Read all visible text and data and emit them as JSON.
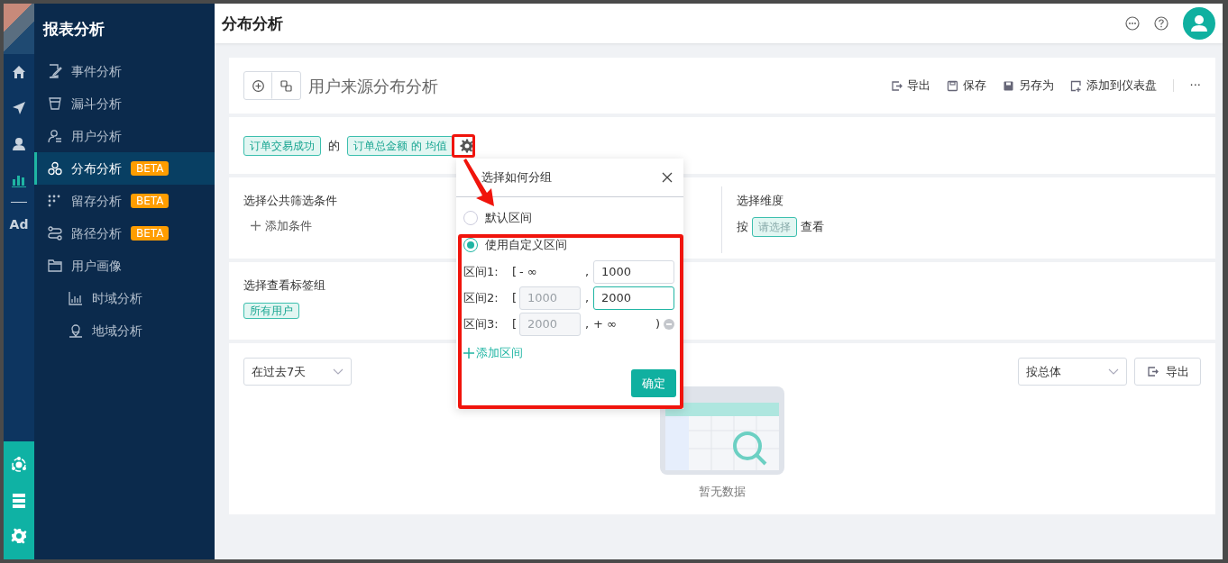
{
  "icon_rail": {
    "items": [
      {
        "selected": false
      },
      {
        "selected": false
      },
      {
        "selected": false
      },
      {
        "selected": true
      },
      {
        "text": "Ad",
        "selected": false
      }
    ]
  },
  "sidebar": {
    "title": "报表分析",
    "items": [
      {
        "label": "事件分析",
        "selected": false
      },
      {
        "label": "漏斗分析",
        "selected": false
      },
      {
        "label": "用户分析",
        "selected": false
      },
      {
        "label": "分布分析",
        "badge": "BETA",
        "selected": true
      },
      {
        "label": "留存分析",
        "badge": "BETA",
        "selected": false
      },
      {
        "label": "路径分析",
        "badge": "BETA",
        "selected": false
      },
      {
        "label": "用户画像",
        "selected": false,
        "children": [
          {
            "label": "时域分析",
            "selected": false
          },
          {
            "label": "地域分析",
            "selected": false
          }
        ]
      }
    ]
  },
  "header": {
    "title": "分布分析"
  },
  "report": {
    "title": "用户来源分布分析",
    "actions": [
      {
        "label": "导出"
      },
      {
        "label": "保存"
      },
      {
        "label": "另存为"
      },
      {
        "label": "添加到仪表盘"
      }
    ],
    "more": "···"
  },
  "metric": {
    "event_tag": "订单交易成功",
    "connector": "的",
    "measure_tag": "订单总金额 的 均值"
  },
  "filters": {
    "title": "选择公共筛选条件",
    "add_label": "添加条件",
    "dimension_title": "选择维度",
    "dimension_prefix": "按",
    "dimension_placeholder": "请选择",
    "dimension_suffix": "查看"
  },
  "tag_group": {
    "title": "选择查看标签组",
    "tag": "所有用户"
  },
  "result": {
    "time_range": "在过去7天",
    "group_by": "按总体",
    "export_label": "导出",
    "empty_text": "暂无数据"
  },
  "grouping_popup": {
    "title": "选择如何分组",
    "options": [
      {
        "label": "默认区间",
        "selected": false
      },
      {
        "label": "使用自定义区间",
        "selected": true
      }
    ],
    "intervals": [
      {
        "label": "区间1:",
        "open": "[",
        "lower": {
          "kind": "text",
          "text": "- ∞"
        },
        "separator": ",",
        "upper": {
          "kind": "input",
          "value": "1000",
          "disabled": false,
          "focused": false
        },
        "removable": false
      },
      {
        "label": "区间2:",
        "open": "[",
        "lower": {
          "kind": "input",
          "value": "1000",
          "disabled": true,
          "focused": false
        },
        "separator": ",",
        "upper": {
          "kind": "input",
          "value": "2000",
          "disabled": false,
          "focused": true
        },
        "removable": false
      },
      {
        "label": "区间3:",
        "open": "[",
        "lower": {
          "kind": "input",
          "value": "2000",
          "disabled": true,
          "focused": false
        },
        "separator": ",",
        "upper": {
          "kind": "text",
          "text": "+ ∞",
          "close": ")"
        },
        "removable": true
      }
    ],
    "add_label": "添加区间",
    "confirm_label": "确定"
  }
}
